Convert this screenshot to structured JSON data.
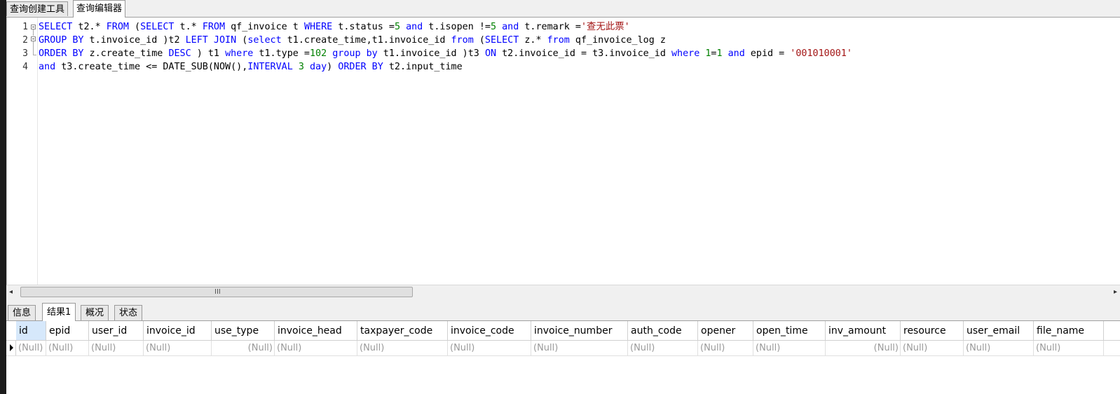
{
  "top_tabs": [
    {
      "label": "查询创建工具",
      "active": false
    },
    {
      "label": "查询编辑器",
      "active": true
    }
  ],
  "editor": {
    "line_numbers": [
      "1",
      "2",
      "3",
      "4"
    ],
    "lines": [
      [
        {
          "t": "SELECT",
          "c": "kw"
        },
        {
          "t": " t2.* ",
          "c": ""
        },
        {
          "t": "FROM",
          "c": "kw"
        },
        {
          "t": " (",
          "c": ""
        },
        {
          "t": "SELECT",
          "c": "kw"
        },
        {
          "t": " t.* ",
          "c": ""
        },
        {
          "t": "FROM",
          "c": "kw"
        },
        {
          "t": " qf_invoice t ",
          "c": ""
        },
        {
          "t": "WHERE",
          "c": "kw"
        },
        {
          "t": " t.status =",
          "c": ""
        },
        {
          "t": "5",
          "c": "num"
        },
        {
          "t": " ",
          "c": ""
        },
        {
          "t": "and",
          "c": "kw"
        },
        {
          "t": " t.isopen !=",
          "c": ""
        },
        {
          "t": "5",
          "c": "num"
        },
        {
          "t": " ",
          "c": ""
        },
        {
          "t": "and",
          "c": "kw"
        },
        {
          "t": " t.remark =",
          "c": ""
        },
        {
          "t": "'查无此票'",
          "c": "str"
        }
      ],
      [
        {
          "t": "GROUP BY",
          "c": "kw"
        },
        {
          "t": " t.invoice_id )t2 ",
          "c": ""
        },
        {
          "t": "LEFT JOIN",
          "c": "kw"
        },
        {
          "t": " (",
          "c": ""
        },
        {
          "t": "select",
          "c": "kw"
        },
        {
          "t": " t1.create_time,t1.invoice_id ",
          "c": ""
        },
        {
          "t": "from",
          "c": "kw"
        },
        {
          "t": " (",
          "c": ""
        },
        {
          "t": "SELECT",
          "c": "kw"
        },
        {
          "t": " z.* ",
          "c": ""
        },
        {
          "t": "from",
          "c": "kw"
        },
        {
          "t": " qf_invoice_log z",
          "c": ""
        }
      ],
      [
        {
          "t": "ORDER BY",
          "c": "kw"
        },
        {
          "t": " z.create_time ",
          "c": ""
        },
        {
          "t": "DESC",
          "c": "kw"
        },
        {
          "t": " ) t1 ",
          "c": ""
        },
        {
          "t": "where",
          "c": "kw"
        },
        {
          "t": " t1.type =",
          "c": ""
        },
        {
          "t": "102",
          "c": "num"
        },
        {
          "t": " ",
          "c": ""
        },
        {
          "t": "group by",
          "c": "kw"
        },
        {
          "t": " t1.invoice_id )t3 ",
          "c": ""
        },
        {
          "t": "ON",
          "c": "kw"
        },
        {
          "t": " t2.invoice_id = t3.invoice_id ",
          "c": ""
        },
        {
          "t": "where",
          "c": "kw"
        },
        {
          "t": " ",
          "c": ""
        },
        {
          "t": "1",
          "c": "num"
        },
        {
          "t": "=",
          "c": ""
        },
        {
          "t": "1",
          "c": "num"
        },
        {
          "t": " ",
          "c": ""
        },
        {
          "t": "and",
          "c": "kw"
        },
        {
          "t": " epid = ",
          "c": ""
        },
        {
          "t": "'001010001'",
          "c": "str"
        }
      ],
      [
        {
          "t": "and",
          "c": "kw"
        },
        {
          "t": " t3.create_time <= DATE_SUB(NOW(),",
          "c": ""
        },
        {
          "t": "INTERVAL",
          "c": "kw"
        },
        {
          "t": " ",
          "c": ""
        },
        {
          "t": "3",
          "c": "num"
        },
        {
          "t": " ",
          "c": ""
        },
        {
          "t": "day",
          "c": "kw"
        },
        {
          "t": ") ",
          "c": ""
        },
        {
          "t": "ORDER BY",
          "c": "kw"
        },
        {
          "t": " t2.input_time",
          "c": ""
        }
      ]
    ]
  },
  "scrollbar": {
    "left_arrow": "◂",
    "right_arrow": "▸",
    "grip": "III"
  },
  "bottom_tabs": [
    {
      "label": "信息",
      "active": false
    },
    {
      "label": "结果1",
      "active": true
    },
    {
      "label": "概况",
      "active": false
    },
    {
      "label": "状态",
      "active": false
    }
  ],
  "result_grid": {
    "columns": [
      "id",
      "epid",
      "user_id",
      "invoice_id",
      "use_type",
      "invoice_head",
      "taxpayer_code",
      "invoice_code",
      "invoice_number",
      "auth_code",
      "opener",
      "open_time",
      "inv_amount",
      "resource",
      "user_email",
      "file_name"
    ],
    "row": [
      "(Null)",
      "(Null)",
      "(Null)",
      "(Null)",
      "(Null)",
      "(Null)",
      "(Null)",
      "(Null)",
      "(Null)",
      "(Null)",
      "(Null)",
      "(Null)",
      "(Null)",
      "(Null)",
      "(Null)",
      "(Null)"
    ]
  }
}
